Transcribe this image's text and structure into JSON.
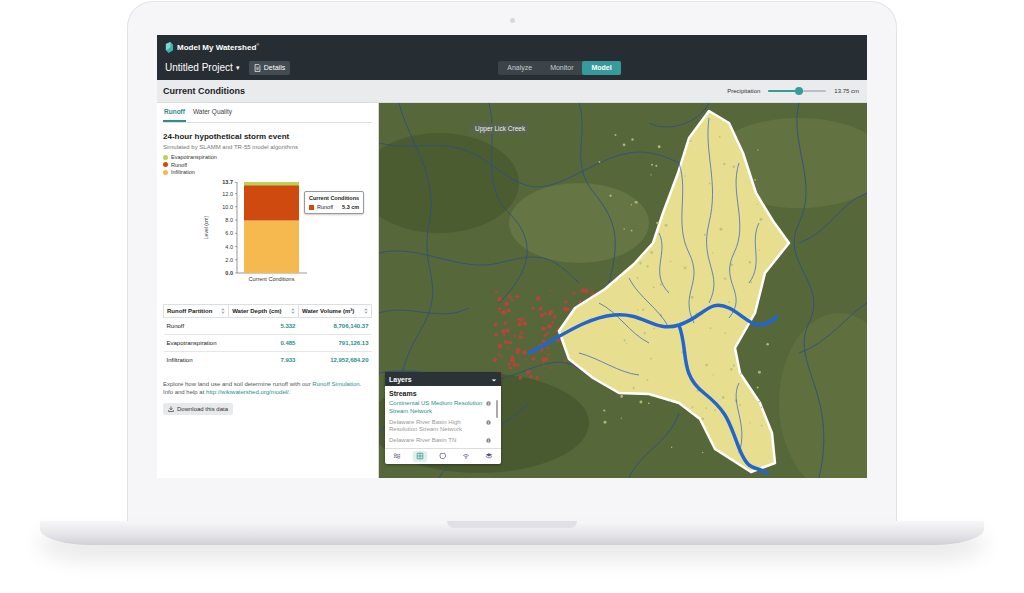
{
  "app": {
    "logo": "Model My Watershed",
    "logo_mark": "®",
    "project": "Untitled Project",
    "project_caret": "▾",
    "details_button": "Details",
    "tabs": [
      {
        "label": "Analyze",
        "selected": false
      },
      {
        "label": "Monitor",
        "selected": false
      },
      {
        "label": "Model",
        "selected": true
      }
    ]
  },
  "toolbar": {
    "title": "Current Conditions",
    "precipitation": {
      "label": "Precipitation",
      "level": 0.53,
      "reading": "13.75 cm"
    }
  },
  "panel": {
    "tabs": [
      {
        "label": "Runoff",
        "selected": true
      },
      {
        "label": "Water Quality",
        "selected": false
      }
    ],
    "title": "24-hour hypothetical storm event",
    "subtitle": "Simulated by SLAMM and TR-55 model algorithms",
    "chart": {
      "y_label": "Level (cm)",
      "x_label": "Current Conditions",
      "ticks": [
        "13.7",
        "12.0",
        "10.0",
        "8.0",
        "6.0",
        "4.0",
        "2.0",
        "0.0"
      ],
      "series": [
        {
          "name": "Evapotranspiration",
          "values": [
            0.485
          ],
          "color": "#b9d24f"
        },
        {
          "name": "Runoff",
          "values": [
            5.332
          ],
          "color": "#cf4a0e"
        },
        {
          "name": "Infiltration",
          "values": [
            7.933
          ],
          "color": "#f5b94f"
        }
      ],
      "tooltip": {
        "title": "Current Conditions",
        "series": "Runoff",
        "value": "5.3 cm"
      }
    },
    "table": {
      "columns": [
        "Runoff Partition",
        "Water Depth (cm)",
        "Water Volume (m³)"
      ],
      "rows": [
        [
          "Runoff",
          "5.332",
          "8,706,140.37"
        ],
        [
          "Evapotranspiration",
          "0.485",
          "791,126.13"
        ],
        [
          "Infiltration",
          "7.933",
          "12,952,684.20"
        ]
      ]
    },
    "note": [
      {
        "text": "Explore how land use and soil determine runoff with our ",
        "link": false
      },
      {
        "text": "Runoff Simulation",
        "link": true
      },
      {
        "text": ". Info and help at ",
        "link": false
      },
      {
        "text": "http://wikiwatershed.org/model/",
        "link": true
      },
      {
        "text": ".",
        "link": false
      }
    ],
    "download": "Download this data"
  },
  "map": {
    "label": "Upper Lick Creek",
    "layers": {
      "title": "Layers",
      "caret": "⌄",
      "section": "Streams",
      "items": [
        {
          "label": "Continental US Medium Resolution Stream Network",
          "selected": true
        },
        {
          "label": "Delaware River Basin High Resolution Stream Network",
          "selected": false
        },
        {
          "label": "Delaware River Basin TN",
          "selected": false
        }
      ]
    },
    "tools": [
      {
        "kind": "streams",
        "selected": false
      },
      {
        "kind": "grid",
        "selected": true
      },
      {
        "kind": "boundary",
        "selected": false
      },
      {
        "kind": "signal",
        "selected": false
      },
      {
        "kind": "stack",
        "selected": false
      }
    ]
  }
}
